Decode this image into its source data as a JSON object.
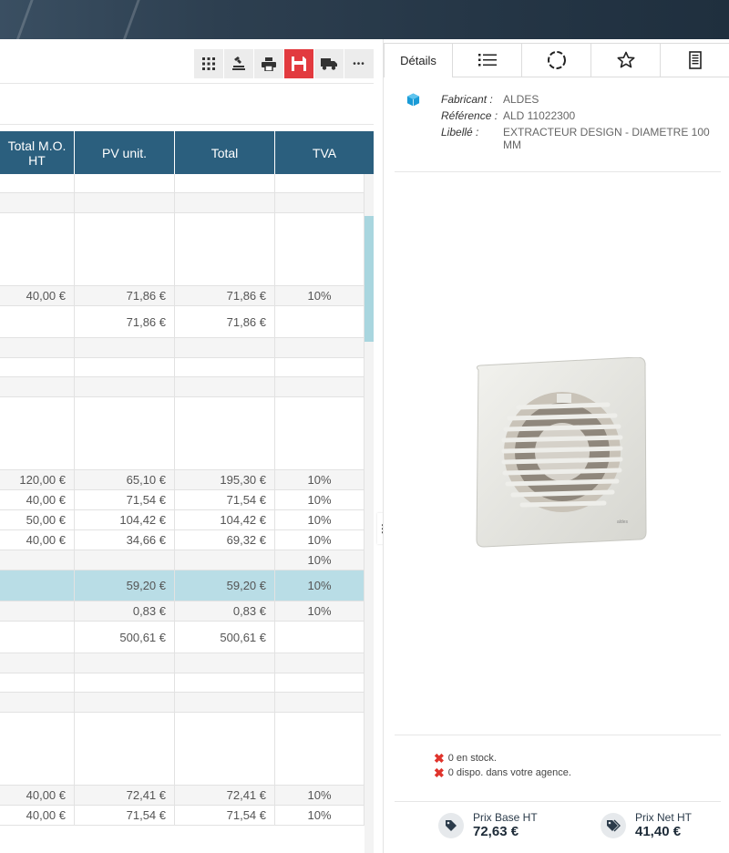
{
  "toolbar": {
    "icons": [
      "grid-icon",
      "stamp-icon",
      "print-icon",
      "save-icon",
      "truck-icon",
      "more-icon"
    ],
    "more_label": "•••"
  },
  "table": {
    "headers": [
      "Total M.O. HT",
      "PV unit.",
      "Total",
      "TVA"
    ],
    "rows": [
      {
        "type": "blank",
        "cells": [
          "",
          "",
          "",
          ""
        ]
      },
      {
        "type": "grey",
        "cells": [
          "",
          "",
          "",
          ""
        ]
      },
      {
        "type": "tall",
        "cells": [
          "",
          "",
          "",
          ""
        ]
      },
      {
        "type": "grey",
        "cells": [
          "40,00 €",
          "71,86 €",
          "71,86 €",
          "10%"
        ]
      },
      {
        "type": "total",
        "cells": [
          "",
          "71,86 €",
          "71,86 €",
          ""
        ]
      },
      {
        "type": "grey",
        "cells": [
          "",
          "",
          "",
          ""
        ]
      },
      {
        "type": "blank",
        "cells": [
          "",
          "",
          "",
          ""
        ]
      },
      {
        "type": "grey",
        "cells": [
          "",
          "",
          "",
          ""
        ]
      },
      {
        "type": "tall",
        "cells": [
          "",
          "",
          "",
          ""
        ]
      },
      {
        "type": "grey",
        "cells": [
          "120,00 €",
          "65,10 €",
          "195,30 €",
          "10%"
        ]
      },
      {
        "type": "normal",
        "cells": [
          "40,00 €",
          "71,54 €",
          "71,54 €",
          "10%"
        ]
      },
      {
        "type": "normal",
        "cells": [
          "50,00 €",
          "104,42 €",
          "104,42 €",
          "10%"
        ]
      },
      {
        "type": "normal",
        "cells": [
          "40,00 €",
          "34,66 €",
          "69,32 €",
          "10%"
        ]
      },
      {
        "type": "grey",
        "cells": [
          "",
          "",
          "",
          "10%"
        ]
      },
      {
        "type": "hl",
        "cells": [
          "",
          "59,20 €",
          "59,20 €",
          "10%"
        ]
      },
      {
        "type": "grey",
        "cells": [
          "",
          "0,83 €",
          "0,83 €",
          "10%"
        ]
      },
      {
        "type": "total",
        "cells": [
          "",
          "500,61 €",
          "500,61 €",
          ""
        ]
      },
      {
        "type": "grey",
        "cells": [
          "",
          "",
          "",
          ""
        ]
      },
      {
        "type": "blank",
        "cells": [
          "",
          "",
          "",
          ""
        ]
      },
      {
        "type": "grey",
        "cells": [
          "",
          "",
          "",
          ""
        ]
      },
      {
        "type": "tall",
        "cells": [
          "",
          "",
          "",
          ""
        ]
      },
      {
        "type": "grey",
        "cells": [
          "40,00 €",
          "72,41 €",
          "72,41 €",
          "10%"
        ]
      },
      {
        "type": "normal",
        "cells": [
          "40,00 €",
          "71,54 €",
          "71,54 €",
          "10%"
        ]
      }
    ]
  },
  "splitter_label": "⋮",
  "panel": {
    "tabs": [
      {
        "label": "Détails",
        "icon": ""
      },
      {
        "label": "",
        "icon": "list-icon"
      },
      {
        "label": "",
        "icon": "circle-dashed-icon"
      },
      {
        "label": "",
        "icon": "star-icon"
      },
      {
        "label": "",
        "icon": "document-icon"
      }
    ],
    "details": {
      "fabricant_label": "Fabricant :",
      "fabricant": "ALDES",
      "reference_label": "Référence :",
      "reference": "ALD 11022300",
      "libelle_label": "Libellé :",
      "libelle": "EXTRACTEUR DESIGN - DIAMETRE 100 MM"
    },
    "stock": {
      "line1": "0 en stock.",
      "line2": "0 dispo. dans votre agence.",
      "mark": "✖"
    },
    "prices": {
      "base_label": "Prix Base HT",
      "base_value": "72,63 €",
      "net_label": "Prix Net HT",
      "net_value": "41,40 €"
    },
    "colors": {
      "header_blue": "#2b5f7e",
      "highlight_row": "#b9dde6",
      "save_red": "#e23a3f",
      "cube_blue": "#1a9bd7",
      "stock_red": "#e0342c"
    }
  }
}
